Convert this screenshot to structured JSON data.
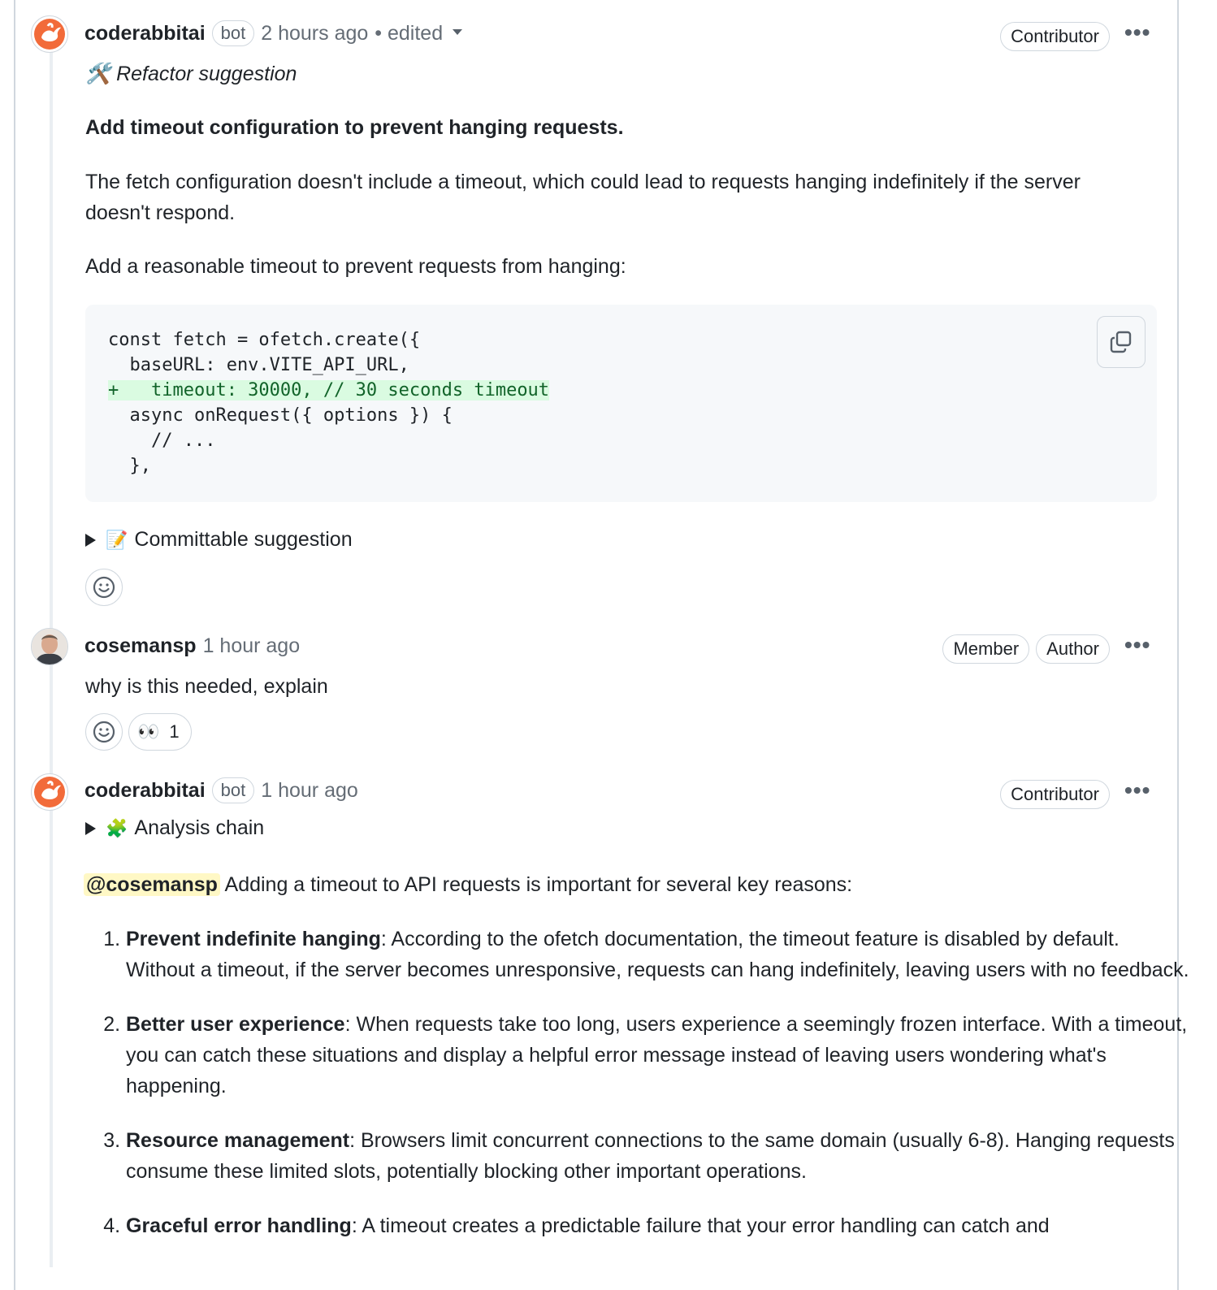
{
  "comment1": {
    "author": "coderabbitai",
    "bot_label": "bot",
    "time": "2 hours ago",
    "edited": "• edited",
    "role": "Contributor",
    "more": "•••",
    "tag": "🛠️ Refactor suggestion",
    "heading": "Add timeout configuration to prevent hanging requests.",
    "para1": "The fetch configuration doesn't include a timeout, which could lead to requests hanging indefinitely if the server doesn't respond.",
    "para2": "Add a reasonable timeout to prevent requests from hanging:",
    "code": {
      "line1": "const fetch = ofetch.create({",
      "line2": "  baseURL: env.VITE_API_URL,",
      "line3": "+   timeout: 30000, // 30 seconds timeout",
      "line4": "  async onRequest({ options }) {",
      "line5": "    // ...",
      "line6": "  },"
    },
    "summary": "Committable suggestion",
    "summary_icon": "📝"
  },
  "comment2": {
    "author": "cosemansp",
    "time": "1 hour ago",
    "roles": [
      "Member",
      "Author"
    ],
    "more": "•••",
    "body": "why is this needed, explain",
    "reaction_emoji": "👀",
    "reaction_count": "1"
  },
  "comment3": {
    "author": "coderabbitai",
    "bot_label": "bot",
    "time": "1 hour ago",
    "role": "Contributor",
    "more": "•••",
    "summary": "Analysis chain",
    "summary_icon": "🧩",
    "mention": "@cosemansp",
    "intro": " Adding a timeout to API requests is important for several key reasons:",
    "reasons": [
      {
        "title": "Prevent indefinite hanging",
        "text": ": According to the ofetch documentation, the timeout feature is disabled by default. Without a timeout, if the server becomes unresponsive, requests can hang indefinitely, leaving users with no feedback."
      },
      {
        "title": "Better user experience",
        "text": ": When requests take too long, users experience a seemingly frozen interface. With a timeout, you can catch these situations and display a helpful error message instead of leaving users wondering what's happening."
      },
      {
        "title": "Resource management",
        "text": ": Browsers limit concurrent connections to the same domain (usually 6-8). Hanging requests consume these limited slots, potentially blocking other important operations."
      },
      {
        "title": "Graceful error handling",
        "text": ": A timeout creates a predictable failure that your error handling can catch and"
      }
    ]
  }
}
